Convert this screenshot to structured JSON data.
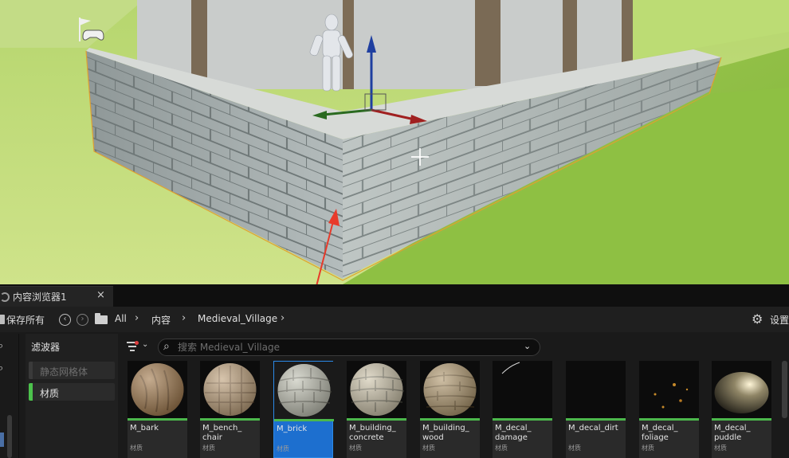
{
  "viewport": {
    "mode_icon": "flag-gamepad-icon"
  },
  "browser": {
    "tab": {
      "label": "内容浏览器1",
      "close": "×"
    },
    "toolbar": {
      "save_all": "保存所有",
      "breadcrumbs": [
        "All",
        "内容",
        "Medieval_Village"
      ],
      "settings": "设置"
    },
    "filters": {
      "title": "滤波器",
      "items": [
        {
          "label": "静态网格体",
          "active": false,
          "color": "#3a3a3a"
        },
        {
          "label": "材质",
          "active": true,
          "color": "#4cc24c"
        }
      ]
    },
    "search": {
      "placeholder": "搜索 Medieval_Village"
    },
    "assets": [
      {
        "name": "M_bark",
        "type": "材质",
        "color": "#a57e52",
        "pattern": "bark",
        "selected": false
      },
      {
        "name": "M_bench_\nchair",
        "type": "材质",
        "color": "#c2a580",
        "pattern": "grid",
        "selected": false
      },
      {
        "name": "M_brick",
        "type": "材质",
        "color": "#c5c6b8",
        "pattern": "brick",
        "selected": true
      },
      {
        "name": "M_building_\nconcrete",
        "type": "材质",
        "color": "#d0c7ae",
        "pattern": "brick",
        "selected": false
      },
      {
        "name": "M_building_\nwood",
        "type": "材质",
        "color": "#b59d74",
        "pattern": "planks",
        "selected": false
      },
      {
        "name": "M_decal_\ndamage",
        "type": "材质",
        "color": "#000000",
        "pattern": "damage",
        "selected": false
      },
      {
        "name": "M_decal_dirt",
        "type": "材质",
        "color": "#000000",
        "pattern": "none",
        "selected": false
      },
      {
        "name": "M_decal_\nfoliage",
        "type": "材质",
        "color": "#000000",
        "pattern": "foliage",
        "selected": false
      },
      {
        "name": "M_decal_\npuddle",
        "type": "材质",
        "color": "#5a5140",
        "pattern": "puddle",
        "selected": false
      }
    ]
  }
}
